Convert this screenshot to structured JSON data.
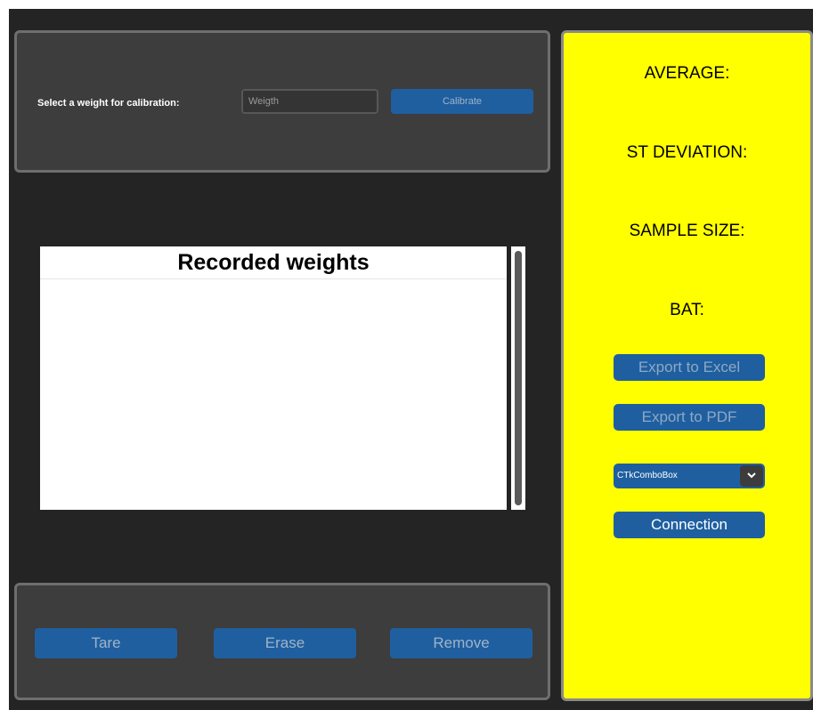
{
  "calibration": {
    "label": "Select a weight for calibration:",
    "input_placeholder": "Weigth",
    "input_value": "",
    "button_label": "Calibrate"
  },
  "recorded": {
    "title": "Recorded weights",
    "items": []
  },
  "actions": {
    "tare": "Tare",
    "erase": "Erase",
    "remove": "Remove"
  },
  "stats": {
    "average": "AVERAGE:",
    "st_deviation": "ST DEVIATION:",
    "sample_size": "SAMPLE SIZE:",
    "bat": "BAT:"
  },
  "side_buttons": {
    "export_excel": "Export to Excel",
    "export_pdf": "Export to PDF",
    "connection": "Connection"
  },
  "combobox": {
    "selected": "CTkComboBox",
    "arrow_icon": "chevron-down-icon"
  },
  "colors": {
    "app_background": "#242424",
    "frame_background": "#3d3d3d",
    "button_blue": "#1f5fa0",
    "side_panel": "#ffff00"
  }
}
